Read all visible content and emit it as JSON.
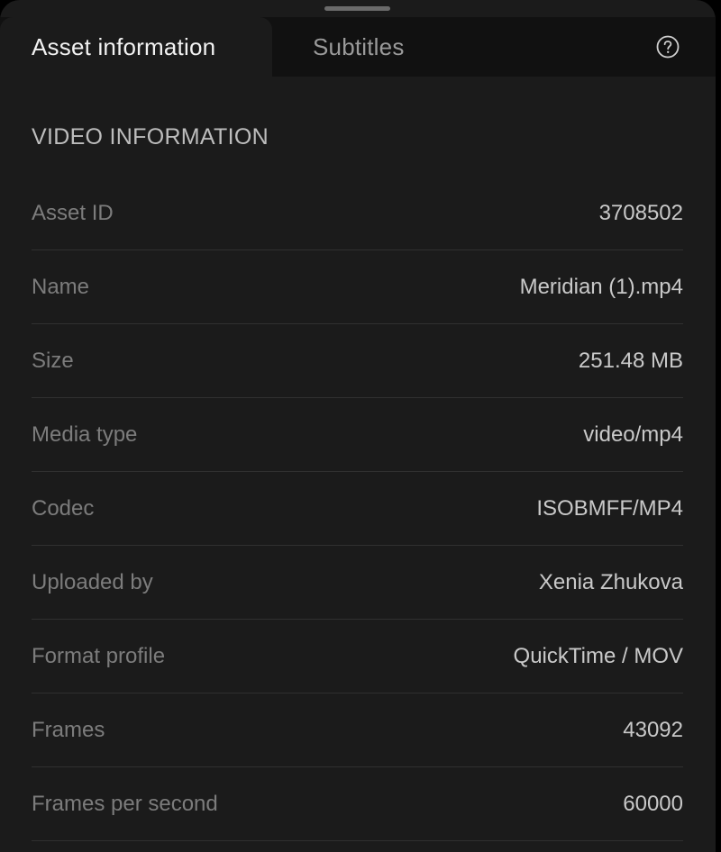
{
  "tabs": {
    "asset_information": "Asset information",
    "subtitles": "Subtitles"
  },
  "section_title": "VIDEO INFORMATION",
  "rows": [
    {
      "label": "Asset ID",
      "value": "3708502"
    },
    {
      "label": "Name",
      "value": "Meridian (1).mp4"
    },
    {
      "label": "Size",
      "value": "251.48 MB"
    },
    {
      "label": "Media type",
      "value": "video/mp4"
    },
    {
      "label": "Codec",
      "value": "ISOBMFF/MP4"
    },
    {
      "label": "Uploaded by",
      "value": "Xenia Zhukova"
    },
    {
      "label": "Format profile",
      "value": "QuickTime / MOV"
    },
    {
      "label": "Frames",
      "value": "43092"
    },
    {
      "label": "Frames per second",
      "value": "60000"
    }
  ],
  "icons": {
    "help": "help-circle-icon",
    "drag_handle": "drag-handle"
  },
  "colors": {
    "background": "#1b1b1b",
    "tabbar": "#111111",
    "active_tab_text": "#f2f2f2",
    "label_text": "#7c7c7c",
    "value_text": "#c9c9c9",
    "divider": "#303030"
  }
}
